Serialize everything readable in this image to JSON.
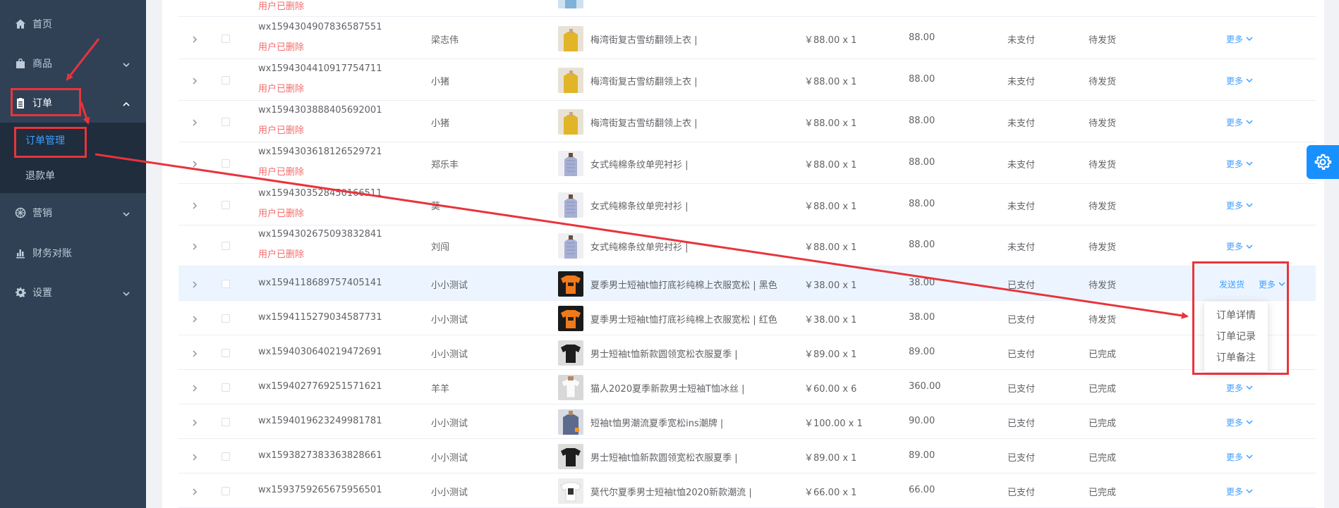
{
  "sidebar": {
    "items": [
      {
        "label": "首页",
        "icon": "home-icon"
      },
      {
        "label": "商品",
        "icon": "shopping-bag-icon"
      },
      {
        "label": "订单",
        "icon": "clipboard-icon"
      },
      {
        "label": "营销",
        "icon": "marketing-icon"
      },
      {
        "label": "财务对账",
        "icon": "bar-chart-icon"
      },
      {
        "label": "设置",
        "icon": "gear-icon"
      }
    ],
    "submenu": [
      {
        "label": "订单管理",
        "active": true
      },
      {
        "label": "退款单",
        "active": false
      }
    ]
  },
  "colors": {
    "sidebar_bg": "#304156",
    "submenu_bg": "#1f2d3d",
    "active": "#409eff",
    "deleted": "#f56c6c",
    "annotation": "#e8343c",
    "float_button": "#1890ff"
  },
  "top_partial": {
    "deleted": "用户已删除"
  },
  "orders": [
    {
      "order_no": "wx1594304907836587551",
      "deleted": "用户已删除",
      "buyer": "梁志伟",
      "product": "梅湾街复古雪纺翻领上衣 |",
      "price": "￥88.00 x 1",
      "amount": "88.00",
      "pay_status": "未支付",
      "ship_status": "待发货",
      "more": "更多",
      "thumb": "yellow-shirt"
    },
    {
      "order_no": "wx1594304410917754711",
      "deleted": "用户已删除",
      "buyer": "小猪",
      "product": "梅湾街复古雪纺翻领上衣 |",
      "price": "￥88.00 x 1",
      "amount": "88.00",
      "pay_status": "未支付",
      "ship_status": "待发货",
      "more": "更多",
      "thumb": "yellow-shirt"
    },
    {
      "order_no": "wx1594303888405692001",
      "deleted": "用户已删除",
      "buyer": "小猪",
      "product": "梅湾街复古雪纺翻领上衣 |",
      "price": "￥88.00 x 1",
      "amount": "88.00",
      "pay_status": "未支付",
      "ship_status": "待发货",
      "more": "更多",
      "thumb": "yellow-shirt"
    },
    {
      "order_no": "wx1594303618126529721",
      "deleted": "用户已删除",
      "buyer": "郑乐丰",
      "product": "女式纯棉条纹单兜衬衫 |",
      "price": "￥88.00 x 1",
      "amount": "88.00",
      "pay_status": "未支付",
      "ship_status": "待发货",
      "more": "更多",
      "thumb": "striped-shirt"
    },
    {
      "order_no": "wx1594303528450166511",
      "deleted": "用户已删除",
      "buyer": "莫",
      "product": "女式纯棉条纹单兜衬衫 |",
      "price": "￥88.00 x 1",
      "amount": "88.00",
      "pay_status": "未支付",
      "ship_status": "待发货",
      "more": "更多",
      "thumb": "striped-shirt"
    },
    {
      "order_no": "wx1594302675093832841",
      "deleted": "用户已删除",
      "buyer": "刘闯",
      "product": "女式纯棉条纹单兜衬衫 |",
      "price": "￥88.00 x 1",
      "amount": "88.00",
      "pay_status": "未支付",
      "ship_status": "待发货",
      "more": "更多",
      "thumb": "striped-shirt"
    },
    {
      "order_no": "wx1594118689757405141",
      "deleted": "",
      "buyer": "小小测试",
      "product": "夏季男士短袖t恤打底衫纯棉上衣服宽松 | 黑色",
      "price": "￥38.00 x 1",
      "amount": "38.00",
      "pay_status": "已支付",
      "ship_status": "待发货",
      "send": "发送货",
      "more": "更多",
      "thumb": "orange-tee"
    },
    {
      "order_no": "wx1594115279034587731",
      "deleted": "",
      "buyer": "小小测试",
      "product": "夏季男士短袖t恤打底衫纯棉上衣服宽松 | 红色",
      "price": "￥38.00 x 1",
      "amount": "38.00",
      "pay_status": "已支付",
      "ship_status": "待发货",
      "more": "",
      "thumb": "orange-tee"
    },
    {
      "order_no": "wx1594030640219472691",
      "deleted": "",
      "buyer": "小小测试",
      "product": "男士短袖t恤新款圆领宽松衣服夏季 |",
      "price": "￥89.00 x 1",
      "amount": "89.00",
      "pay_status": "已支付",
      "ship_status": "已完成",
      "more": "",
      "thumb": "black-tee"
    },
    {
      "order_no": "wx1594027769251571621",
      "deleted": "",
      "buyer": "羊羊",
      "product": "猫人2020夏季新款男士短袖T恤冰丝 |",
      "price": "￥60.00 x 6",
      "amount": "360.00",
      "pay_status": "已支付",
      "ship_status": "已完成",
      "more": "更多",
      "thumb": "white-tee"
    },
    {
      "order_no": "wx1594019623249981781",
      "deleted": "",
      "buyer": "小小测试",
      "product": "短袖t恤男潮流夏季宽松ins潮牌 |",
      "price": "￥100.00 x 1",
      "amount": "90.00",
      "pay_status": "已支付",
      "ship_status": "已完成",
      "more": "更多",
      "thumb": "denim-shirt"
    },
    {
      "order_no": "wx1593827383363828661",
      "deleted": "",
      "buyer": "小小测试",
      "product": "男士短袖t恤新款圆领宽松衣服夏季 |",
      "price": "￥89.00 x 1",
      "amount": "89.00",
      "pay_status": "已支付",
      "ship_status": "已完成",
      "more": "更多",
      "thumb": "black-tee"
    },
    {
      "order_no": "wx1593759265675956501",
      "deleted": "",
      "buyer": "小小测试",
      "product": "莫代尔夏季男士短袖t恤2020新款潮流 |",
      "price": "￥66.00 x 1",
      "amount": "66.00",
      "pay_status": "已支付",
      "ship_status": "已完成",
      "more": "更多",
      "thumb": "print-tee"
    }
  ],
  "dropdown": {
    "items": [
      "订单详情",
      "订单记录",
      "订单备注"
    ]
  },
  "float_button": {
    "icon": "gear-icon"
  }
}
